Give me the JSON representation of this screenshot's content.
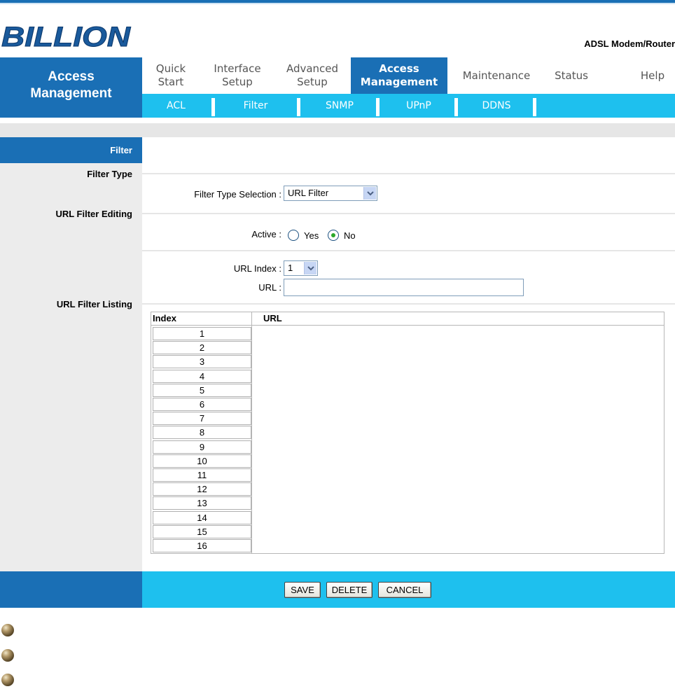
{
  "brand": {
    "logo_text": "BILLION",
    "product": "ADSL Modem/Router"
  },
  "left_title": {
    "line1": "Access",
    "line2": "Management"
  },
  "menu": [
    {
      "line1": "Quick",
      "line2": "Start"
    },
    {
      "line1": "Interface",
      "line2": "Setup"
    },
    {
      "line1": "Advanced",
      "line2": "Setup"
    },
    {
      "line1": "Access",
      "line2": "Management",
      "active": true
    },
    {
      "line1": "Maintenance",
      "line2": ""
    },
    {
      "line1": "Status",
      "line2": ""
    },
    {
      "line1": "Help",
      "line2": ""
    }
  ],
  "submenu": [
    "ACL",
    "Filter",
    "SNMP",
    "UPnP",
    "DDNS"
  ],
  "sidebar": {
    "filter": "Filter",
    "filter_type": "Filter Type",
    "url_filter_editing": "URL Filter Editing",
    "url_filter_listing": "URL Filter Listing"
  },
  "form": {
    "filter_type_label": "Filter Type Selection :",
    "filter_type_value": "URL Filter",
    "active_label": "Active :",
    "active_yes": "Yes",
    "active_no": "No",
    "active_selected": "No",
    "url_index_label": "URL Index :",
    "url_index_value": "1",
    "url_label": "URL :",
    "url_value": ""
  },
  "table": {
    "headers": [
      "Index",
      "URL"
    ],
    "rows": [
      "1",
      "2",
      "3",
      "4",
      "5",
      "6",
      "7",
      "8",
      "9",
      "10",
      "11",
      "12",
      "13",
      "14",
      "15",
      "16"
    ]
  },
  "buttons": {
    "save": "SAVE",
    "delete": "DELETE",
    "cancel": "CANCEL"
  },
  "colors": {
    "dark_blue": "#1a6fb5",
    "light_blue": "#1ec0ee",
    "gray": "#ececec"
  },
  "icons": {
    "bullet": "bullet-icon",
    "dropdown": "chevron-down-icon"
  }
}
